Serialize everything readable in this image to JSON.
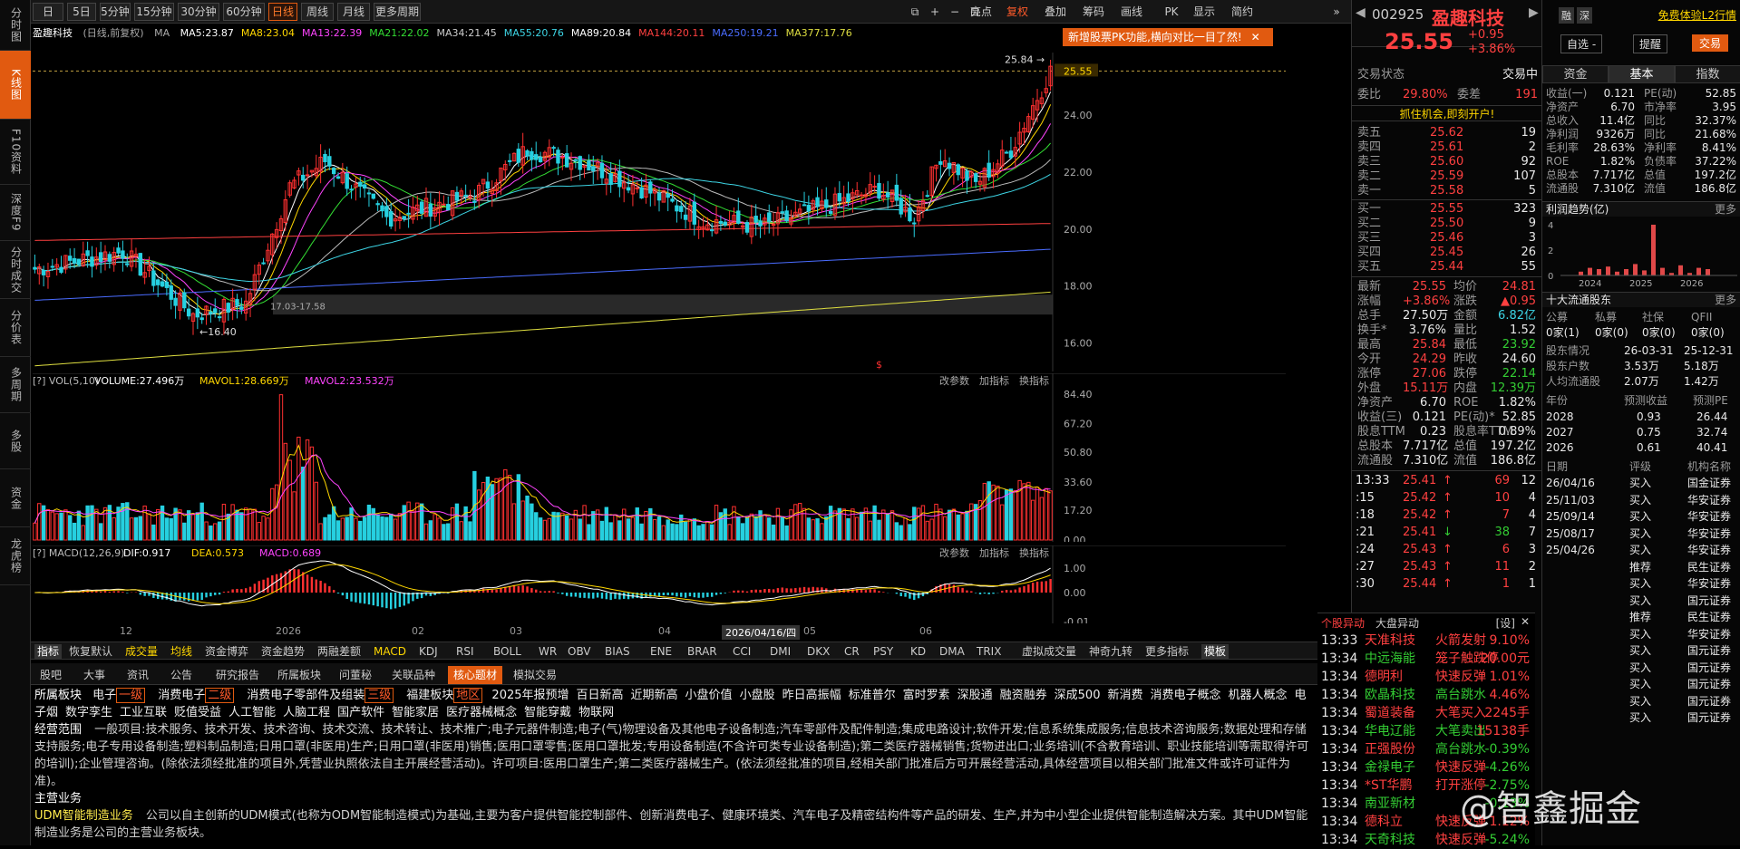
{
  "nav": [
    "分时图",
    "K线图",
    "F10资料",
    "深度F9",
    "分时成交",
    "分价表",
    "多周期",
    "多股",
    "资金",
    "龙虎榜"
  ],
  "toolbar": {
    "periods": [
      "日",
      "5日",
      "5分钟",
      "15分钟",
      "30分钟",
      "60分钟",
      "日线",
      "周线",
      "月线",
      "更多周期"
    ],
    "right": [
      "亮点",
      "复权",
      "叠加",
      "筹码",
      "画线",
      "PK",
      "显示",
      "简约"
    ]
  },
  "stock": {
    "code": "002925",
    "name": "盈趣科技",
    "price": "25.55",
    "change": "+0.95",
    "change_pct": "+3.86%",
    "badges": [
      "融",
      "深"
    ],
    "l2": "免费体验L2行情",
    "actions": [
      "自选 -",
      "提醒",
      "交易"
    ]
  },
  "ma_line": {
    "title": "盈趣科技",
    "mode": "(日线,前复权)",
    "items": [
      {
        "label": "MA5:23.87",
        "color": "#ffffff"
      },
      {
        "label": "MA8:23.04",
        "color": "#ffd700"
      },
      {
        "label": "MA13:22.39",
        "color": "#ff44ff"
      },
      {
        "label": "MA21:22.02",
        "color": "#33dd33"
      },
      {
        "label": "MA34:21.45",
        "color": "#cccccc"
      },
      {
        "label": "MA55:20.76",
        "color": "#3dd5e5"
      },
      {
        "label": "MA89:20.84",
        "color": "#ffffff"
      },
      {
        "label": "MA144:20.11",
        "color": "#ff4040"
      },
      {
        "label": "MA250:19.21",
        "color": "#4a6cff"
      },
      {
        "label": "MA377:17.76",
        "color": "#dede40"
      }
    ]
  },
  "popup": "新增股票PK功能,横向对比一目了然!",
  "price_chart": {
    "axis": [
      "25.55",
      "24.00",
      "22.00",
      "20.00",
      "18.00",
      "16.00"
    ],
    "high_label": "25.84",
    "low_label": "16.40",
    "range_label": "17.03-17.58"
  },
  "volume": {
    "title": "VOL(5,10)",
    "items": [
      "VOLUME:27.496万",
      "MAVOL1:28.669万",
      "MAVOL2:23.532万"
    ],
    "axis": [
      "84.40",
      "67.20",
      "50.80",
      "33.60",
      "17.20",
      "0.00"
    ],
    "buttons": [
      "改参数",
      "加指标",
      "换指标"
    ]
  },
  "macd": {
    "title": "MACD(12,26,9)",
    "items": [
      "DIF:0.917",
      "DEA:0.573",
      "MACD:0.689"
    ],
    "axis": [
      "1.00",
      "0.00",
      "-0.01"
    ],
    "buttons": [
      "改参数",
      "加指标",
      "换指标"
    ]
  },
  "dates": [
    "12",
    "2026",
    "02",
    "03",
    "04",
    "2026/04/16/四",
    "05",
    "06"
  ],
  "indicators": [
    "指标",
    "恢复默认",
    "成交量",
    "均线",
    "资金博弈",
    "资金趋势",
    "两融差额",
    "MACD",
    "KDJ",
    "RSI",
    "BOLL",
    "WR",
    "OBV",
    "BIAS",
    "ENE",
    "BRAR",
    "CCI",
    "DMI",
    "DKX",
    "CR",
    "PSY",
    "KD",
    "DMA",
    "TRIX",
    "虚拟成交量",
    "神奇九转",
    "更多指标",
    "模板"
  ],
  "bottom_tabs": [
    "股吧",
    "大事",
    "资讯",
    "公告",
    "研究报告",
    "所属板块",
    "问董秘",
    "关联品种",
    "核心题材",
    "模拟交易"
  ],
  "info": {
    "sector_label": "所属板块",
    "sectors": [
      {
        "name": "电子",
        "tag": "一级"
      },
      {
        "name": "消费电子",
        "tag": "二级"
      },
      {
        "name": "消费电子零部件及组装",
        "tag": "三级"
      },
      {
        "name": "福建板块",
        "tag": "地区"
      }
    ],
    "concepts": [
      "2025年报预增",
      "百日新高",
      "近期新高",
      "小盘价值",
      "小盘股",
      "昨日高振幅",
      "标准普尔",
      "富时罗素",
      "深股通",
      "融资融券",
      "深成500",
      "新消费",
      "消费电子概念",
      "机器人概念",
      "电子烟",
      "数字孪生",
      "工业互联",
      "贬值受益",
      "人工智能",
      "人脑工程",
      "国产软件",
      "智能家居",
      "医疗器械概念",
      "智能穿戴",
      "物联网"
    ],
    "scope_label": "经营范围",
    "scope": "一般项目:技术服务、技术开发、技术咨询、技术交流、技术转让、技术推广;电子元器件制造;电子(气)物理设备及其他电子设备制造;汽车零部件及配件制造;集成电路设计;软件开发;信息系统集成服务;信息技术咨询服务;数据处理和存储支持服务;电子专用设备制造;塑料制品制造;日用口罩(非医用)生产;日用口罩(非医用)销售;医用口罩零售;医用口罩批发;专用设备制造(不含许可类专业设备制造);第二类医疗器械销售;货物进出口;业务培训(不含教育培训、职业技能培训等需取得许可的培训);企业管理咨询。(除依法须经批准的项目外,凭营业执照依法自主开展经营活动)。许可项目:医用口罩生产;第二类医疗器械生产。(依法须经批准的项目,经相关部门批准后方可开展经营活动,具体经营项目以相关部门批准文件或许可证件为准)。",
    "main_label": "主营业务",
    "main_title": "UDM智能制造业务",
    "main_text": "公司以自主创新的UDM模式(也称为ODM智能制造模式)为基础,主要为客户提供智能控制部件、创新消费电子、健康环境类、汽车电子及精密结构件等产品的研发、生产,并为中小型企业提供智能制造解决方案。其中UDM智能制造业务是公司的主营业务板块。"
  },
  "quote": {
    "header": [
      "交易状态",
      "交易中"
    ],
    "weibi": [
      "委比",
      "29.80%",
      "委差",
      "191"
    ],
    "banner": "抓住机会,即刻开户!",
    "asks": [
      [
        "卖五",
        "25.62",
        "19"
      ],
      [
        "卖四",
        "25.61",
        "2"
      ],
      [
        "卖三",
        "25.60",
        "92"
      ],
      [
        "卖二",
        "25.59",
        "107"
      ],
      [
        "卖一",
        "25.58",
        "5"
      ]
    ],
    "bids": [
      [
        "买一",
        "25.55",
        "323"
      ],
      [
        "买二",
        "25.50",
        "9"
      ],
      [
        "买三",
        "25.46",
        "3"
      ],
      [
        "买四",
        "25.45",
        "26"
      ],
      [
        "买五",
        "25.44",
        "55"
      ]
    ],
    "stats": [
      [
        "最新",
        "25.55",
        "均价",
        "24.81"
      ],
      [
        "涨幅",
        "+3.86%",
        "涨跌",
        "▲0.95"
      ],
      [
        "总手",
        "27.50万",
        "金额",
        "6.82亿"
      ],
      [
        "换手*",
        "3.76%",
        "量比",
        "1.52"
      ],
      [
        "最高",
        "25.84",
        "最低",
        "23.92"
      ],
      [
        "今开",
        "24.29",
        "昨收",
        "24.60"
      ],
      [
        "涨停",
        "27.06",
        "跌停",
        "22.14"
      ],
      [
        "外盘",
        "15.11万",
        "内盘",
        "12.39万"
      ],
      [
        "净资产",
        "6.70",
        "ROE",
        "1.82%"
      ],
      [
        "收益(三)",
        "0.121",
        "PE(动)*",
        "52.85"
      ],
      [
        "股息TTM",
        "0.23",
        "股息率TTM",
        "0.89%"
      ],
      [
        "总股本",
        "7.717亿",
        "总值",
        "197.2亿"
      ],
      [
        "流通股",
        "7.310亿",
        "流值",
        "186.8亿"
      ]
    ],
    "ticks": [
      [
        "13:33",
        "25.41",
        "69",
        "12"
      ],
      [
        ":15",
        "25.42",
        "10",
        "4"
      ],
      [
        ":18",
        "25.42",
        "7",
        "4"
      ],
      [
        ":21",
        "25.41",
        "38",
        "7"
      ],
      [
        ":24",
        "25.43",
        "6",
        "3"
      ],
      [
        ":27",
        "25.43",
        "11",
        "2"
      ],
      [
        ":30",
        "25.44",
        "1",
        "1"
      ]
    ]
  },
  "alerts": {
    "tabs": [
      "个股异动",
      "大盘异动"
    ],
    "rows": [
      [
        "13:33",
        "天准科技",
        "火箭发射",
        "9.10%"
      ],
      [
        "13:34",
        "中远海能",
        "笼子触跌停",
        "20.00元"
      ],
      [
        "13:34",
        "德明利",
        "快速反弹",
        "1.01%"
      ],
      [
        "13:34",
        "欧晶科技",
        "高台跳水",
        "4.46%"
      ],
      [
        "13:34",
        "蜀道装备",
        "大笔买入",
        "2245手"
      ],
      [
        "13:34",
        "华电辽能",
        "大笔卖出",
        "15138手"
      ],
      [
        "13:34",
        "正强股份",
        "高台跳水",
        "-0.39%"
      ],
      [
        "13:34",
        "金禄电子",
        "快速反弹",
        "-4.26%"
      ],
      [
        "13:34",
        "*ST华鹏",
        "打开涨停",
        "-2.75%"
      ],
      [
        "13:34",
        "南亚新材",
        "",
        "-0.13%"
      ],
      [
        "13:34",
        "德科立",
        "快速反弹",
        "1.12%"
      ],
      [
        "13:34",
        "天奇科技",
        "快速反弹",
        "-5.24%"
      ]
    ]
  },
  "f10": {
    "tabs": [
      "资金",
      "基本",
      "指数"
    ],
    "basic": [
      [
        "收益(一)",
        "0.121",
        "PE(动)",
        "52.85"
      ],
      [
        "净资产",
        "6.70",
        "市净率",
        "3.95"
      ],
      [
        "总收入",
        "11.4亿",
        "同比",
        "32.37%"
      ],
      [
        "净利润",
        "9326万",
        "同比",
        "21.68%"
      ],
      [
        "毛利率",
        "28.63%",
        "净利率",
        "8.41%"
      ],
      [
        "ROE",
        "1.82%",
        "负债率",
        "37.22%"
      ],
      [
        "总股本",
        "7.717亿",
        "总值",
        "197.2亿"
      ],
      [
        "流通股",
        "7.310亿",
        "流值",
        "186.8亿"
      ]
    ],
    "profit_title": "利润趋势(亿)",
    "more": "更多",
    "profit_axis": [
      "4",
      "2",
      "0"
    ],
    "profit_years": [
      "2024",
      "2025",
      "2026"
    ],
    "profit_bars": [
      0.3,
      0.6,
      0.5,
      0.7,
      0.3,
      0.5,
      0.9,
      0.4,
      4.0,
      0.6,
      0.2,
      0.8,
      0.2,
      0.6,
      0.5
    ],
    "holders_title": "十大流通股东",
    "holders_hdr": [
      "公募",
      "私募",
      "社保",
      "QFII"
    ],
    "holders_vals": [
      "0家(1)",
      "0家(0)",
      "0家(0)",
      "0家(0)"
    ],
    "holders_info": [
      [
        "股东情况",
        "26-03-31",
        "25-12-31"
      ],
      [
        "股东户数",
        "3.53万",
        "5.18万"
      ],
      [
        "人均流通股",
        "2.07万",
        "1.42万"
      ]
    ],
    "forecast_hdr": [
      "年份",
      "预测收益",
      "预测PE"
    ],
    "forecast": [
      [
        "2028",
        "0.93",
        "26.44"
      ],
      [
        "2027",
        "0.75",
        "32.74"
      ],
      [
        "2026",
        "0.61",
        "40.41"
      ]
    ],
    "rating_hdr": [
      "日期",
      "评级",
      "机构名称"
    ],
    "ratings": [
      [
        "26/04/16",
        "买入",
        "国金证券"
      ],
      [
        "25/11/03",
        "买入",
        "华安证券"
      ],
      [
        "25/09/14",
        "买入",
        "华安证券"
      ],
      [
        "25/08/17",
        "买入",
        "华安证券"
      ],
      [
        "25/04/26",
        "买入",
        "华安证券"
      ],
      [
        "",
        "推荐",
        "民生证券"
      ],
      [
        "",
        "买入",
        "华安证券"
      ],
      [
        "",
        "买入",
        "国元证券"
      ],
      [
        "",
        "推荐",
        "民生证券"
      ],
      [
        "",
        "买入",
        "华安证券"
      ],
      [
        "",
        "买入",
        "国元证券"
      ],
      [
        "",
        "买入",
        "国元证券"
      ],
      [
        "",
        "买入",
        "国元证券"
      ],
      [
        "",
        "买入",
        "国元证券"
      ],
      [
        "",
        "买入",
        "国元证券"
      ]
    ]
  },
  "watermark": "@智鑫掘金"
}
